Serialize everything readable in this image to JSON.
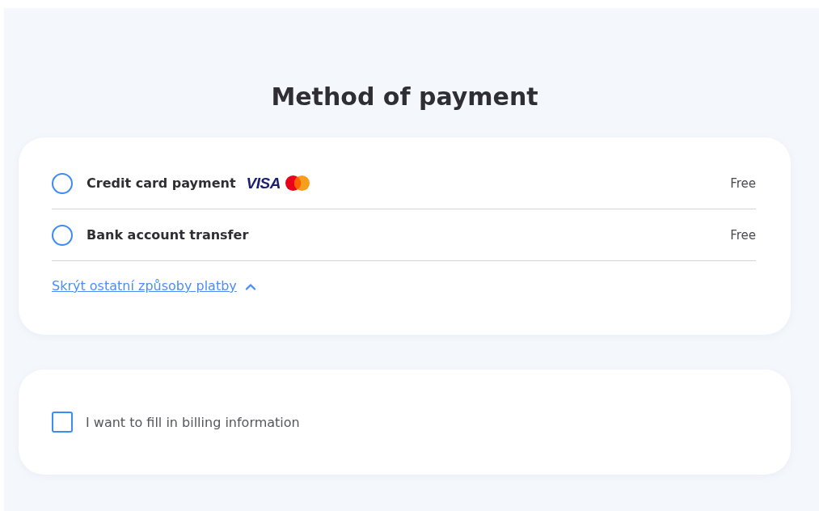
{
  "title": "Method of payment",
  "payment_methods": [
    {
      "label": "Credit card payment",
      "price": "Free",
      "selected": false,
      "logos": [
        {
          "kind": "visa",
          "text": "VISA"
        },
        {
          "kind": "mastercard"
        }
      ]
    },
    {
      "label": "Bank account transfer",
      "price": "Free",
      "selected": false
    }
  ],
  "toggle_link": {
    "label": "Skrýt ostatní způsoby platby",
    "expanded": true
  },
  "billing": {
    "label": "I want to fill in billing information",
    "checked": false
  }
}
